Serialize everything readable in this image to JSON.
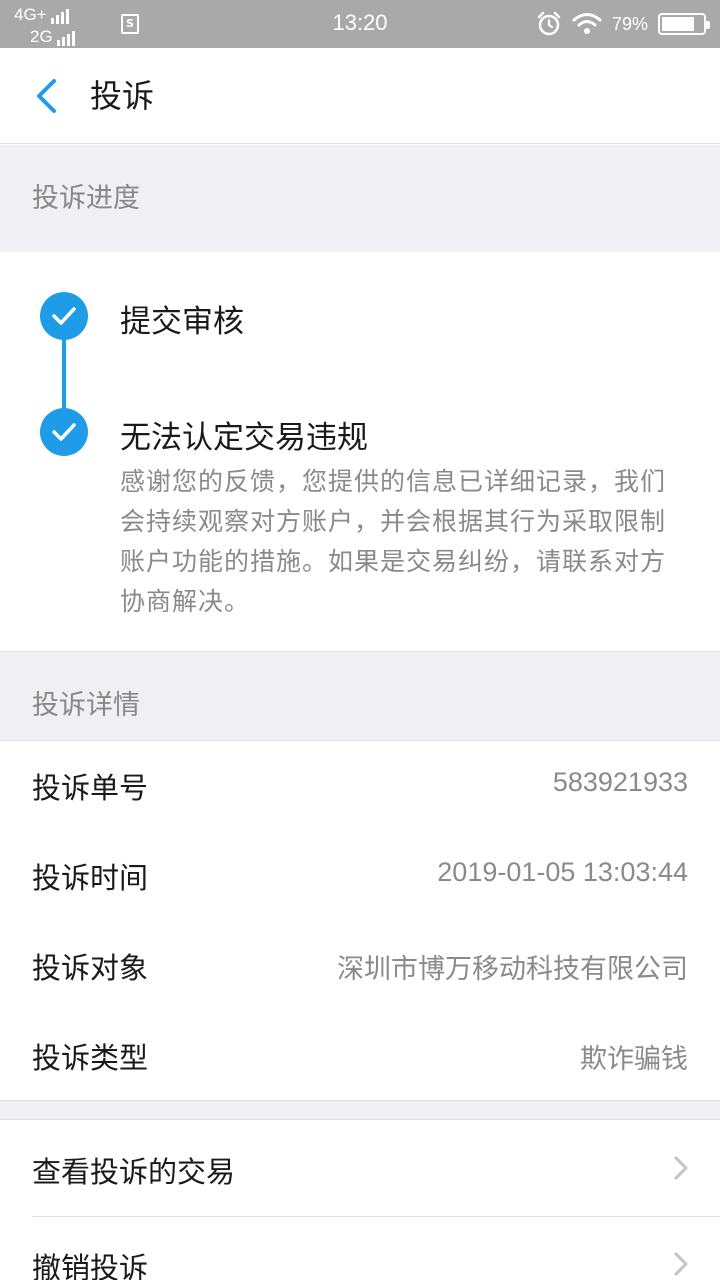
{
  "status_bar": {
    "network_top": "4G+",
    "network_bottom": "2G",
    "sim_badge": "S",
    "time": "13:20",
    "battery_text": "79%",
    "battery_level": 0.79,
    "icons": [
      "alarm-icon",
      "wifi-icon",
      "battery-icon"
    ]
  },
  "header": {
    "title": "投诉",
    "back_icon": "chevron-left-icon"
  },
  "progress": {
    "section_title": "投诉进度",
    "steps": [
      {
        "title": "提交审核",
        "icon": "check-icon"
      },
      {
        "title": "无法认定交易违规",
        "icon": "check-icon",
        "description": "感谢您的反馈，您提供的信息已详细记录，我们会持续观察对方账户，并会根据其行为采取限制账户功能的措施。如果是交易纠纷，请联系对方协商解决。"
      }
    ]
  },
  "details": {
    "section_title": "投诉详情",
    "rows": [
      {
        "label": "投诉单号",
        "value": "583921933"
      },
      {
        "label": "投诉时间",
        "value": "2019-01-05 13:03:44"
      },
      {
        "label": "投诉对象",
        "value": "深圳市博万移动科技有限公司"
      },
      {
        "label": "投诉类型",
        "value": "欺诈骗钱"
      }
    ]
  },
  "actions": [
    {
      "label": "查看投诉的交易",
      "icon": "chevron-right-icon"
    },
    {
      "label": "撤销投诉",
      "icon": "chevron-right-icon"
    }
  ],
  "colors": {
    "accent": "#1e9ce8",
    "status_bar": "#a9a9a9",
    "section_bg": "#efeff4",
    "muted_text": "#8a8a8a"
  }
}
